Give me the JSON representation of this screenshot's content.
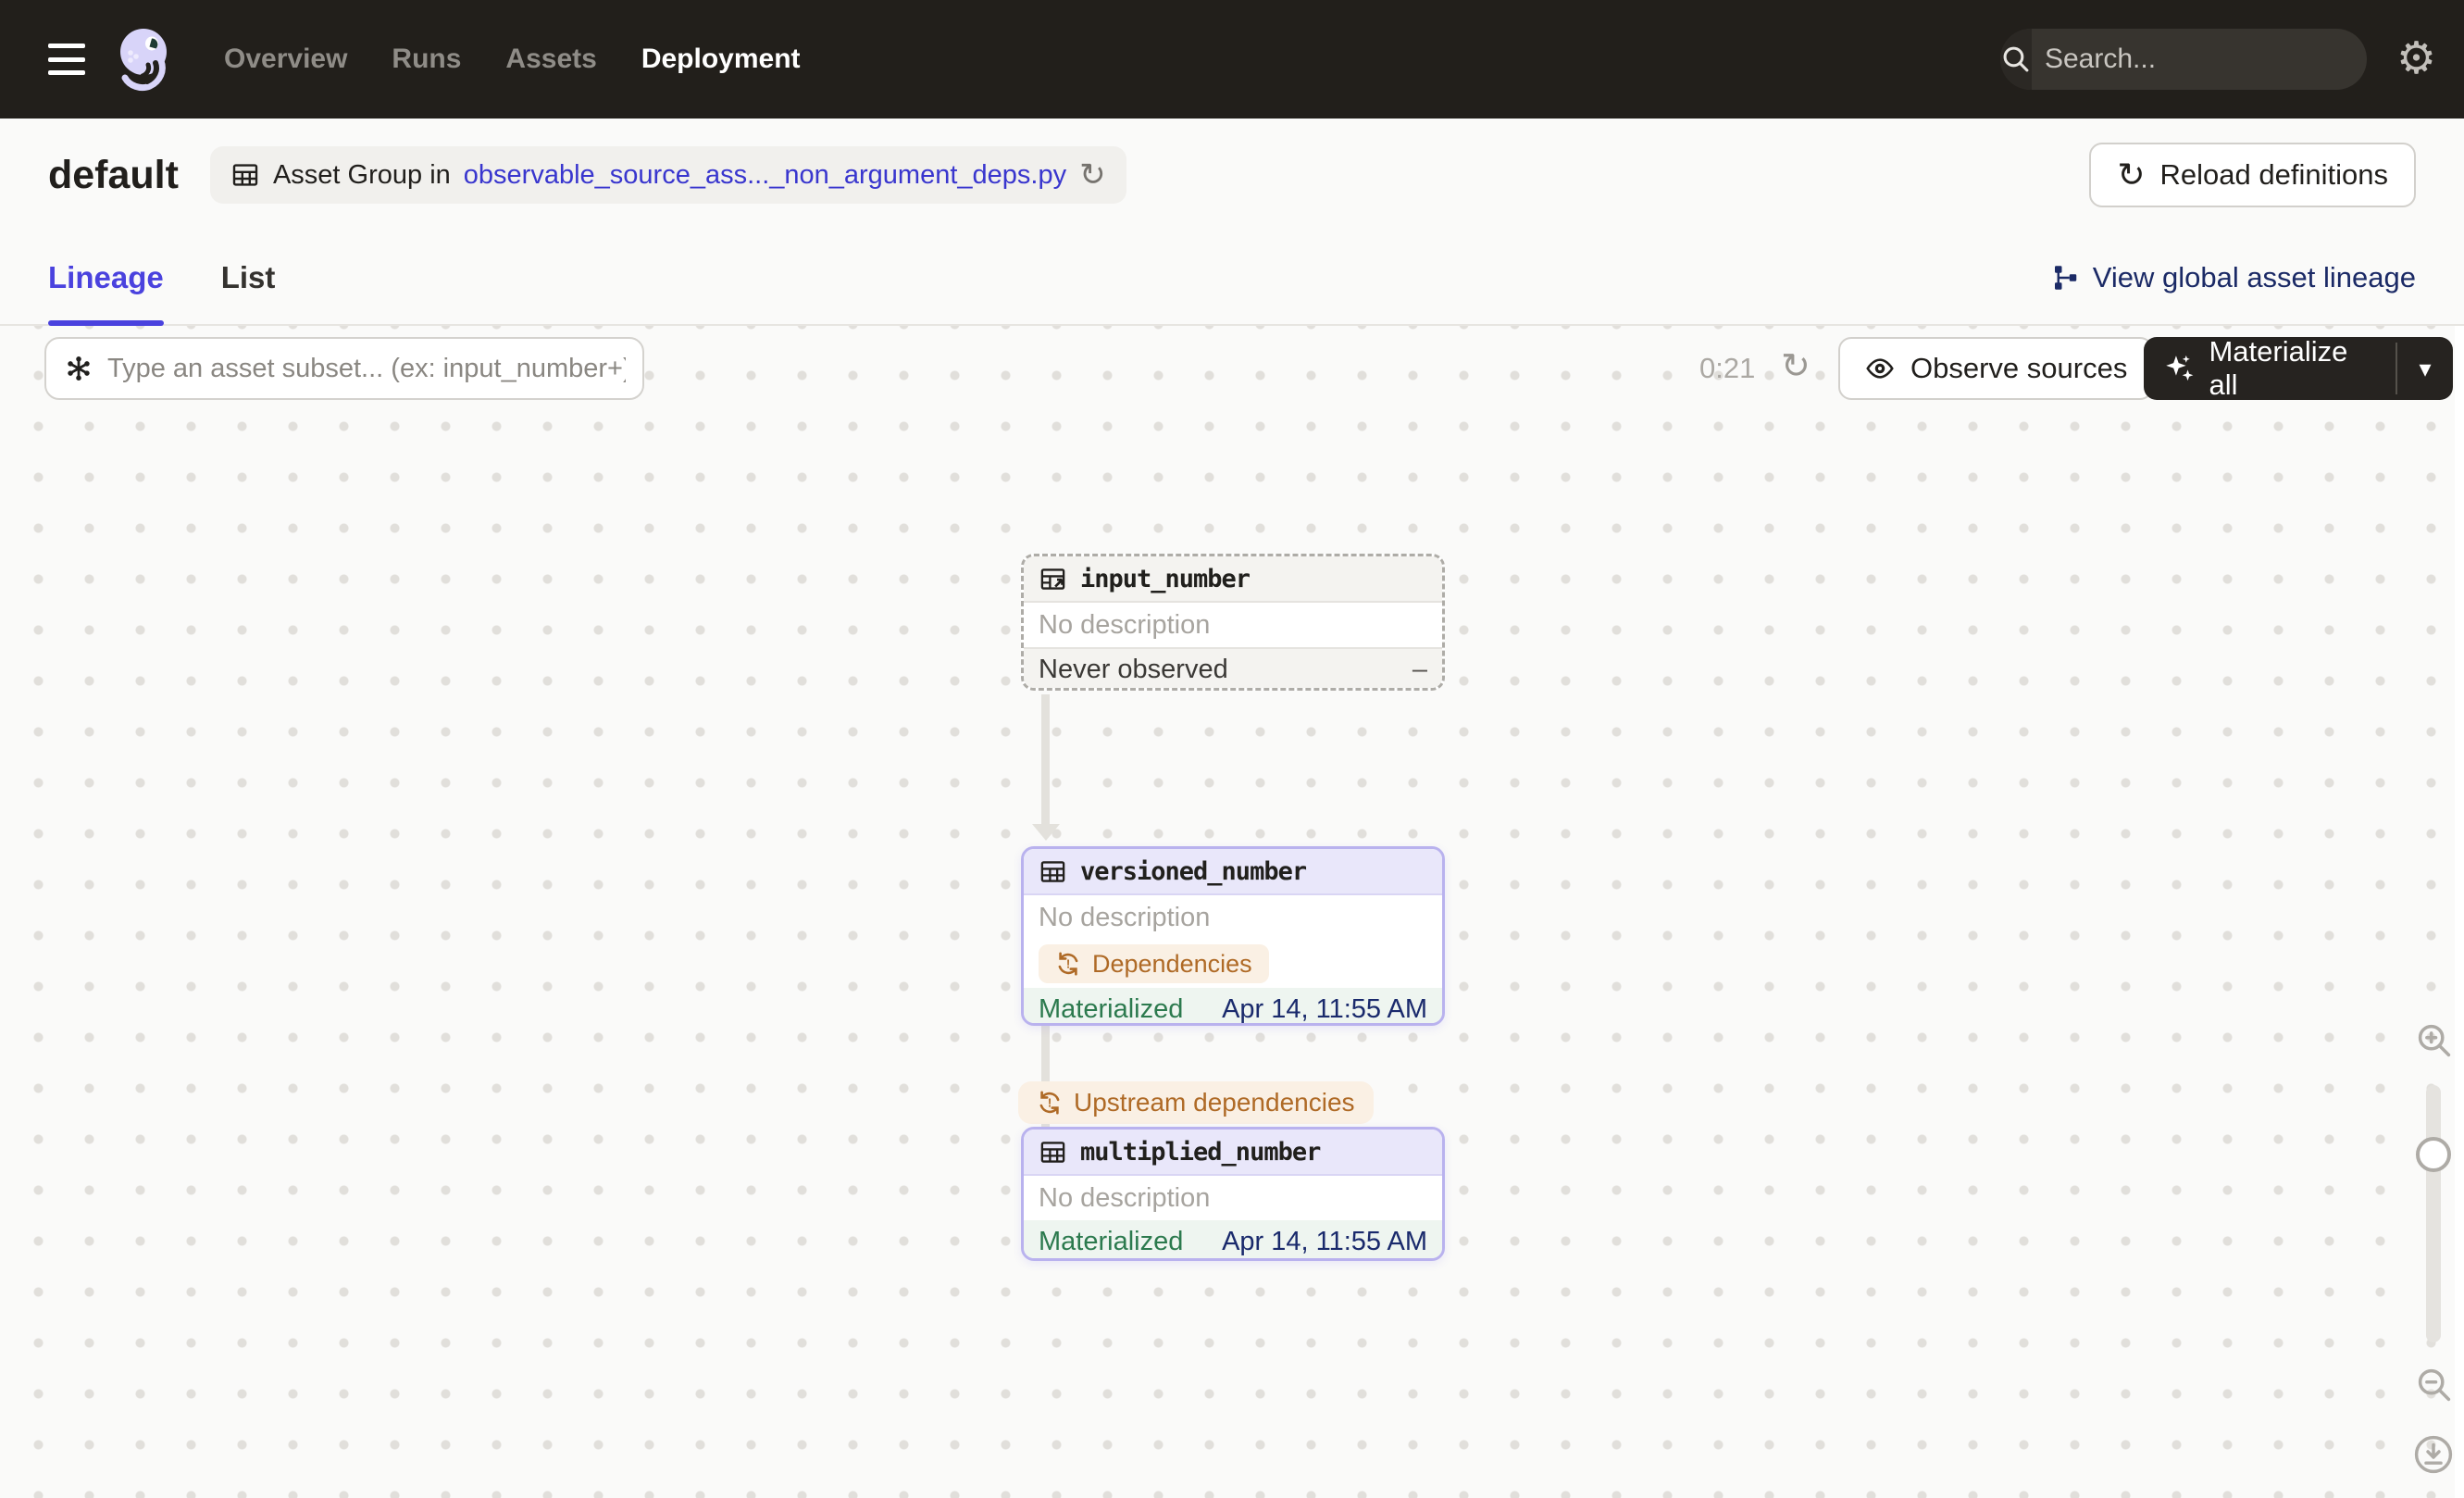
{
  "nav": {
    "items": [
      {
        "label": "Overview",
        "active": false
      },
      {
        "label": "Runs",
        "active": false
      },
      {
        "label": "Assets",
        "active": false
      },
      {
        "label": "Deployment",
        "active": true
      }
    ],
    "search": {
      "placeholder": "Search...",
      "shortcut": "/"
    }
  },
  "header": {
    "title": "default",
    "breadcrumb": {
      "prefix": "Asset Group in",
      "link": "observable_source_ass..._non_argument_deps.py"
    },
    "reload_button": "Reload definitions"
  },
  "tabs": [
    {
      "label": "Lineage",
      "active": true
    },
    {
      "label": "List",
      "active": false
    }
  ],
  "lineage_toolbar": {
    "view_global_link": "View global asset lineage",
    "filter_placeholder": "Type an asset subset... (ex: input_number+)",
    "timer": "0:21",
    "observe_button": "Observe sources",
    "materialize_button": "Materialize all"
  },
  "graph": {
    "edge_label": "Upstream dependencies",
    "nodes": [
      {
        "name": "input_number",
        "type": "observable-source-asset",
        "description": "No description",
        "status_label": "Never observed",
        "status_value": "–"
      },
      {
        "name": "versioned_number",
        "type": "asset",
        "description": "No description",
        "badge": "Dependencies",
        "status_label": "Materialized",
        "status_value": "Apr 14, 11:55 AM"
      },
      {
        "name": "multiplied_number",
        "type": "asset",
        "description": "No description",
        "status_label": "Materialized",
        "status_value": "Apr 14, 11:55 AM"
      }
    ]
  },
  "icons": {
    "gear": "⚙",
    "refresh": "↻",
    "caret_down": "▾"
  },
  "colors": {
    "nav_bg": "#221F1B",
    "accent_indigo": "#4A42DE",
    "link_indigo": "#3936CE",
    "success_green": "#2C7A4E",
    "timestamp_navy": "#1A2A6C",
    "warning_amber": "#AF6A26",
    "node_border_purple": "#B9B2EE",
    "node_header_purple": "#E9E7FA",
    "canvas_bg": "#FAFAF9"
  }
}
